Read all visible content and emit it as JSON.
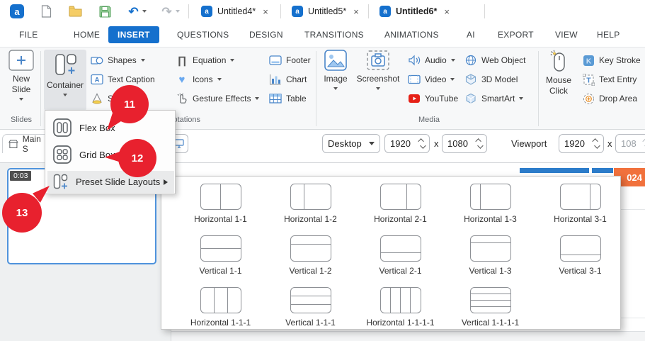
{
  "colors": {
    "accent": "#1570cd",
    "red": "#e8212e",
    "orange": "#f1713c",
    "bar_blue": "#2c7cca",
    "thumb_border": "#4f93dc",
    "icon_blue": "#4a86c9"
  },
  "glyphs": {
    "logo": "a",
    "undo": "↶",
    "redo": "↷",
    "close": "×",
    "heart": "♥",
    "pi": "∏",
    "caption_a": "A",
    "key_k": "K",
    "entry_t": "T"
  },
  "doc_tabs": {
    "items": [
      {
        "label": "Untitled4*"
      },
      {
        "label": "Untitled5*"
      },
      {
        "label": "Untitled6*"
      }
    ],
    "active": "Untitled6*"
  },
  "menu": {
    "tabs": [
      "FILE",
      "HOME",
      "INSERT",
      "QUESTIONS",
      "DESIGN",
      "TRANSITIONS",
      "ANIMATIONS",
      "AI",
      "EXPORT",
      "VIEW",
      "HELP"
    ],
    "active": "INSERT"
  },
  "ribbon": {
    "groups": {
      "slides": "Slides",
      "annotations": "Annotations",
      "media": "Media"
    },
    "items": {
      "new_slide": "New Slide",
      "container": "Container",
      "shapes": "Shapes",
      "text_caption": "Text Caption",
      "spotlight": "Spotlight",
      "equation": "Equation",
      "icons": "Icons",
      "gesture_effects": "Gesture Effects",
      "footer": "Footer",
      "chart": "Chart",
      "table": "Table",
      "image": "Image",
      "screenshot": "Screenshot",
      "audio": "Audio",
      "video": "Video",
      "youtube": "YouTube",
      "web_object": "Web Object",
      "model_3d": "3D Model",
      "smartart": "SmartArt",
      "mouse_click": "Mouse Click",
      "key_stroke": "Key Stroke",
      "text_entry": "Text Entry",
      "drop_area": "Drop Area"
    }
  },
  "container_menu": {
    "items": [
      {
        "label": "Flex Box"
      },
      {
        "label": "Grid Box"
      },
      {
        "label": "Preset Slide Layouts",
        "submenu": true,
        "highlighted": true
      }
    ]
  },
  "layout_menu": {
    "items": [
      {
        "label": "Horizontal 1-1",
        "dir": "h",
        "parts": [
          1,
          1
        ]
      },
      {
        "label": "Horizontal 1-2",
        "dir": "h",
        "parts": [
          1,
          2
        ]
      },
      {
        "label": "Horizontal 2-1",
        "dir": "h",
        "parts": [
          2,
          1
        ]
      },
      {
        "label": "Horizontal 1-3",
        "dir": "h",
        "parts": [
          1,
          3
        ]
      },
      {
        "label": "Horizontal 3-1",
        "dir": "h",
        "parts": [
          3,
          1
        ]
      },
      {
        "label": "Vertical 1-1",
        "dir": "v",
        "parts": [
          1,
          1
        ]
      },
      {
        "label": "Vertical 1-2",
        "dir": "v",
        "parts": [
          1,
          2
        ]
      },
      {
        "label": "Vertical 2-1",
        "dir": "v",
        "parts": [
          2,
          1
        ]
      },
      {
        "label": "Vertical 1-3",
        "dir": "v",
        "parts": [
          1,
          3
        ]
      },
      {
        "label": "Vertical 3-1",
        "dir": "v",
        "parts": [
          3,
          1
        ]
      },
      {
        "label": "Horizontal 1-1-1",
        "dir": "h",
        "parts": [
          1,
          1,
          1
        ]
      },
      {
        "label": "Vertical 1-1-1",
        "dir": "v",
        "parts": [
          1,
          1,
          1
        ]
      },
      {
        "label": "Horizontal 1-1-1-1",
        "dir": "h",
        "parts": [
          1,
          1,
          1,
          1
        ]
      },
      {
        "label": "Vertical 1-1-1-1",
        "dir": "v",
        "parts": [
          1,
          1,
          1,
          1
        ]
      }
    ]
  },
  "device_bar": {
    "device": "Desktop",
    "slide_width": "1920",
    "slide_height": "1080",
    "times": "x",
    "viewport_label": "Viewport",
    "viewport_width": "1920",
    "viewport_height_partial": "108"
  },
  "scene_tab": {
    "label": "Main S"
  },
  "slide_panel": {
    "duration": "0:03"
  },
  "canvas": {
    "orange_label": "024"
  },
  "annotations": {
    "badge_11": "11",
    "badge_12": "12",
    "badge_13": "13"
  }
}
